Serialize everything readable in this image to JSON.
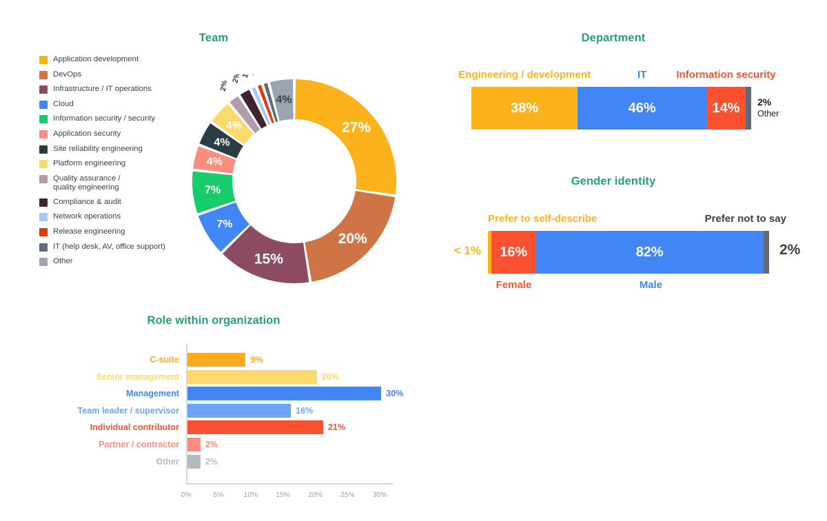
{
  "palette": {
    "title_green": "#22a17e",
    "amber": "#fbb21b",
    "terracotta": "#ce7445",
    "plum": "#8c4a63",
    "blue": "#4285f4",
    "green": "#17cc6b",
    "salmon": "#f98d7f",
    "dark_slate": "#2b3c44",
    "light_yellow": "#fbd96b",
    "mauve_grey": "#b49aac",
    "dark_plum": "#3f2430",
    "light_blue": "#a8c7f7",
    "red_orange": "#e03c0c",
    "slate_grey": "#5f6b76",
    "grey": "#9aa5b1",
    "red": "#fa5130",
    "dark_grey": "#5f6368",
    "light_amber": "#ffc940",
    "text_dark": "#3c4043",
    "axis_grey": "#9aa0a6"
  },
  "team": {
    "title": "Team",
    "chart_data": {
      "type": "pie",
      "title": "Team",
      "categories": [
        "Application development",
        "DevOps",
        "Infrastructure / IT operations",
        "Cloud",
        "Information security / security",
        "Application security",
        "Site reliability engineering",
        "Platform engineering",
        "Quality assurance /\nquality engineering",
        "Compliance & audit",
        "Network operations",
        "Release engineering",
        "IT (help desk, AV, office support)",
        "Other"
      ],
      "values": [
        27,
        20,
        15,
        7,
        7,
        4,
        4,
        4,
        2,
        2,
        1,
        1,
        1,
        4
      ],
      "labels": [
        "27%",
        "20%",
        "15%",
        "7%",
        "7%",
        "4%",
        "4%",
        "4%",
        "2%",
        "2%",
        "1%",
        "1%",
        "1%",
        "4%"
      ],
      "colors": [
        "#fbb21b",
        "#ce7445",
        "#8c4a63",
        "#4285f4",
        "#17cc6b",
        "#f98d7f",
        "#2b3c44",
        "#fbd96b",
        "#b49aac",
        "#3f2430",
        "#a8c7f7",
        "#e03c0c",
        "#5f6b76",
        "#9aa5b1"
      ],
      "label_text_colors": [
        "#ffffff",
        "#ffffff",
        "#ffffff",
        "#ffffff",
        "#ffffff",
        "#ffffff",
        "#ffffff",
        "#ffffff",
        "#3c4043",
        "#3c4043",
        "#3c4043",
        "#3c4043",
        "#3c4043",
        "#3c4043"
      ],
      "legend_position": "left",
      "donut": true
    }
  },
  "department": {
    "title": "Department",
    "chart_data": {
      "type": "bar",
      "orientation": "stacked-horizontal",
      "title": "Department",
      "categories": [
        "Engineering / development",
        "IT",
        "Information security",
        "Other"
      ],
      "values": [
        38,
        46,
        14,
        2
      ],
      "labels": [
        "38%",
        "46%",
        "14%",
        "2%"
      ],
      "colors": [
        "#fbb21b",
        "#4285f4",
        "#fa5130",
        "#5f6b76"
      ],
      "label_placement": [
        "inside",
        "inside",
        "inside",
        "outside"
      ],
      "category_label_colors": [
        "#fbb21b",
        "#4285f4",
        "#fa5130",
        "#202124"
      ],
      "total": 100
    }
  },
  "gender": {
    "title": "Gender identity",
    "chart_data": {
      "type": "bar",
      "orientation": "stacked-horizontal",
      "title": "Gender identity",
      "categories": [
        "Prefer to self-describe",
        "Female",
        "Male",
        "Prefer not to say"
      ],
      "values": [
        0.5,
        16,
        82,
        2
      ],
      "labels": [
        "< 1%",
        "16%",
        "82%",
        "2%"
      ],
      "colors": [
        "#fbb21b",
        "#fa5130",
        "#4285f4",
        "#5f6b76"
      ],
      "label_placement": [
        "outside-left",
        "inside",
        "inside",
        "outside-right"
      ],
      "category_label_positions": [
        "top",
        "bottom",
        "bottom",
        "top"
      ],
      "category_label_colors": [
        "#fbb21b",
        "#fa5130",
        "#4285f4",
        "#3c4043"
      ],
      "total": 100
    }
  },
  "role": {
    "title": "Role within organization",
    "chart_data": {
      "type": "bar",
      "orientation": "horizontal",
      "title": "Role within organization",
      "categories": [
        "C-suite",
        "Senior management",
        "Management",
        "Team leader / supervisor",
        "Individual contributor",
        "Partner / contractor",
        "Other"
      ],
      "values": [
        9,
        20,
        30,
        16,
        21,
        2,
        2
      ],
      "labels": [
        "9%",
        "20%",
        "30%",
        "16%",
        "21%",
        "2%",
        "2%"
      ],
      "colors": [
        "#fbab20",
        "#fbd96b",
        "#4285f4",
        "#6ba4f8",
        "#fa5130",
        "#f98d7f",
        "#b6babd"
      ],
      "xlabel": "",
      "ylabel": "",
      "xlim": [
        0,
        32
      ],
      "xticks": [
        "0%",
        "5%",
        "10%",
        "15%",
        "20%",
        "25%",
        "30%"
      ],
      "xtick_values": [
        0,
        5,
        10,
        15,
        20,
        25,
        30
      ],
      "grid": false
    }
  }
}
